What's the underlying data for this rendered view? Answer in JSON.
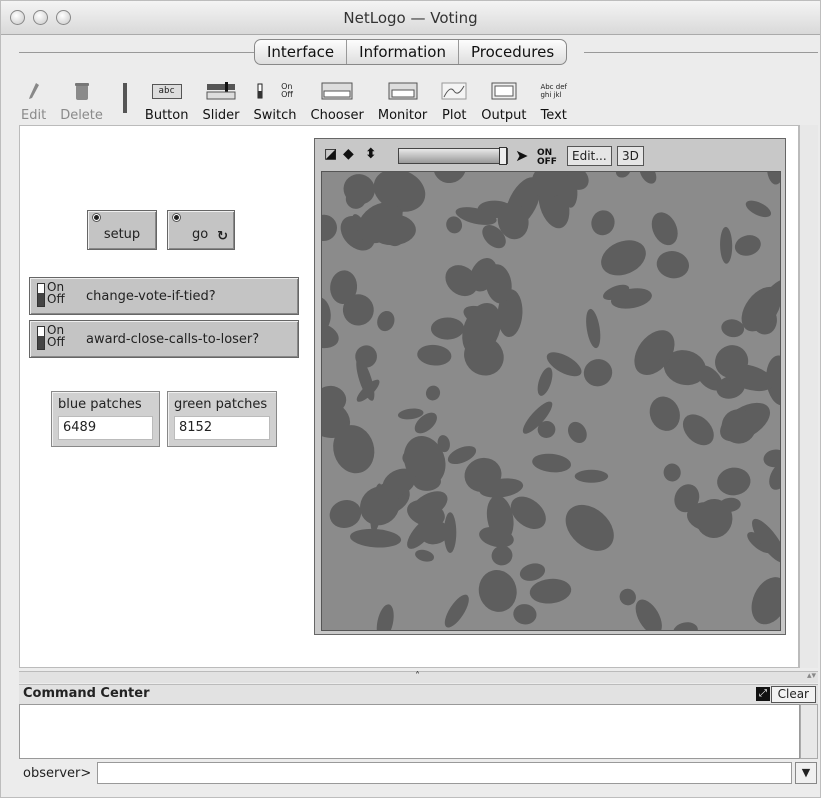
{
  "window": {
    "title": "NetLogo — Voting"
  },
  "tabs": [
    "Interface",
    "Information",
    "Procedures"
  ],
  "toolbar": {
    "edit": "Edit",
    "delete": "Delete",
    "button": "Button",
    "slider": "Slider",
    "switch": "Switch",
    "chooser": "Chooser",
    "monitor": "Monitor",
    "plot": "Plot",
    "output": "Output",
    "text": "Text",
    "icon_abc": "abc",
    "icon_on": "On",
    "icon_off": "Off",
    "icon_text_a": "Abc def",
    "icon_text_b": "ghi jkl"
  },
  "buttons": {
    "setup": "setup",
    "go": "go"
  },
  "switches": {
    "on_label": "On",
    "off_label": "Off",
    "change_vote": "change-vote-if-tied?",
    "award_close": "award-close-calls-to-loser?"
  },
  "monitors": {
    "blue_label": "blue patches",
    "blue_value": "6489",
    "green_label": "green patches",
    "green_value": "8152"
  },
  "view": {
    "edit": "Edit...",
    "three_d": "3D",
    "updates_on": "ON",
    "updates_off": "OFF",
    "speed_fraction": 1.0
  },
  "command_center": {
    "title": "Command Center",
    "clear": "Clear",
    "prompt": "observer>",
    "input_value": ""
  },
  "colors": {
    "world_light": "#8b8b8b",
    "world_dark": "#5e5e5e",
    "widget_gray": "#c4c4c4"
  }
}
